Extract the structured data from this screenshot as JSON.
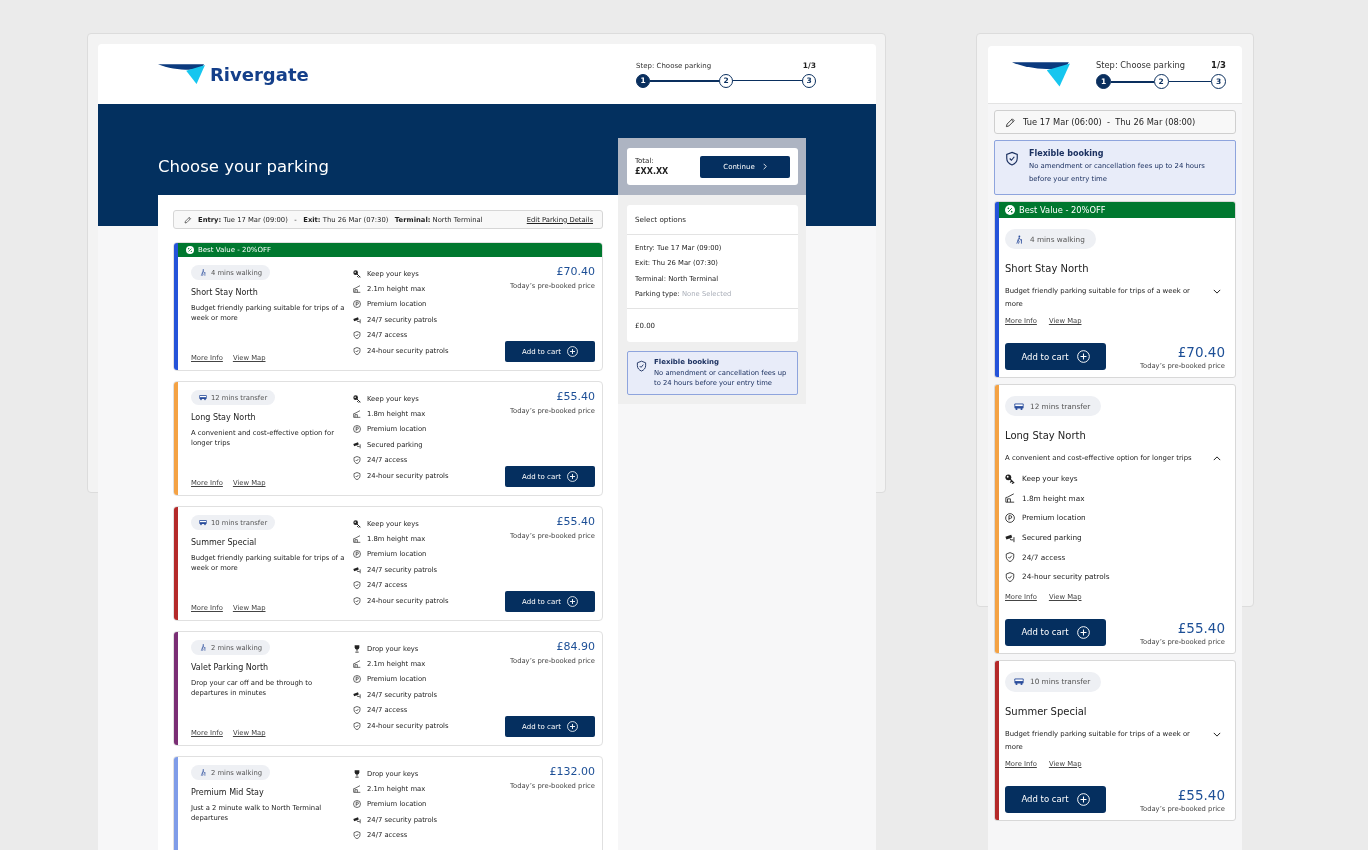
{
  "desktop": {
    "header": {
      "brand": "Rivergate",
      "stepper": {
        "label": "Step: Choose parking",
        "count": "1/3",
        "steps": [
          {
            "number": "1",
            "selected": true
          },
          {
            "number": "2",
            "selected": false
          },
          {
            "number": "3",
            "selected": false
          }
        ]
      }
    },
    "hero_title": "Choose your parking",
    "trip_bar": {
      "summary": "**Entry:** Tue 17 Mar (09:00)   -   **Exit:** Thu 26 Mar (07:30)   **Terminal:** North Terminal",
      "edit_link": "Edit Parking Details"
    },
    "cards": [
      {
        "color": "#2553d9",
        "banner": "Best Value - 20%OFF",
        "badge": {
          "kind": "walking",
          "text": "4 mins walking"
        },
        "name": "Short Stay North",
        "description": "Budget friendly parking suitable for trips of a week or more",
        "features": [
          {
            "kind": "keys",
            "text": "Keep your keys"
          },
          {
            "kind": "height",
            "text": "2.1m height max"
          },
          {
            "kind": "location",
            "text": "Premium location"
          },
          {
            "kind": "cctv",
            "text": "24/7 security patrols"
          },
          {
            "kind": "shield",
            "text": "24/7 access"
          },
          {
            "kind": "shield",
            "text": "24-hour security patrols"
          }
        ],
        "links": [
          "More Info",
          "View Map"
        ],
        "price": "£70.40",
        "price_note": "Today’s pre-booked price",
        "button": "Add to cart"
      },
      {
        "color": "#f4a244",
        "badge": {
          "kind": "transfer",
          "text": "12 mins transfer"
        },
        "name": "Long Stay North",
        "description": "A convenient and cost-effective option for longer trips",
        "features": [
          {
            "kind": "keys",
            "text": "Keep your keys"
          },
          {
            "kind": "height",
            "text": "1.8m height max"
          },
          {
            "kind": "location",
            "text": "Premium location"
          },
          {
            "kind": "cctv",
            "text": "Secured parking"
          },
          {
            "kind": "shield",
            "text": "24/7 access"
          },
          {
            "kind": "shield",
            "text": "24-hour security patrols"
          }
        ],
        "links": [
          "More Info",
          "View Map"
        ],
        "price": "£55.40",
        "price_note": "Today’s pre-booked price",
        "button": "Add to cart"
      },
      {
        "color": "#b42a2a",
        "badge": {
          "kind": "transfer",
          "text": "10 mins transfer"
        },
        "name": "Summer Special",
        "description": "Budget friendly parking suitable for trips of a week or more",
        "features": [
          {
            "kind": "keys",
            "text": "Keep your keys"
          },
          {
            "kind": "height",
            "text": "1.8m height max"
          },
          {
            "kind": "location",
            "text": "Premium location"
          },
          {
            "kind": "cctv",
            "text": "24/7 security patrols"
          },
          {
            "kind": "shield",
            "text": "24/7 access"
          },
          {
            "kind": "shield",
            "text": "24-hour security patrols"
          }
        ],
        "links": [
          "More Info",
          "View Map"
        ],
        "price": "£55.40",
        "price_note": "Today’s pre-booked price",
        "button": "Add to cart"
      },
      {
        "color": "#7a2e74",
        "badge": {
          "kind": "walking",
          "text": "2 mins walking"
        },
        "name": "Valet Parking North",
        "description": "Drop your car off and be through to departures in minutes",
        "features": [
          {
            "kind": "valet",
            "text": "Drop your keys"
          },
          {
            "kind": "height",
            "text": "2.1m height max"
          },
          {
            "kind": "location",
            "text": "Premium location"
          },
          {
            "kind": "cctv",
            "text": "24/7 security patrols"
          },
          {
            "kind": "shield",
            "text": "24/7 access"
          },
          {
            "kind": "shield",
            "text": "24-hour security patrols"
          }
        ],
        "links": [
          "More Info",
          "View Map"
        ],
        "price": "£84.90",
        "price_note": "Today’s pre-booked price",
        "button": "Add to cart"
      },
      {
        "color": "#7f9ce8",
        "badge": {
          "kind": "walking",
          "text": "2 mins walking"
        },
        "name": "Premium Mid Stay",
        "description": "Just a 2 minute walk to North Terminal departures",
        "features": [
          {
            "kind": "valet",
            "text": "Drop your keys"
          },
          {
            "kind": "height",
            "text": "2.1m height max"
          },
          {
            "kind": "location",
            "text": "Premium location"
          },
          {
            "kind": "cctv",
            "text": "24/7 security patrols"
          },
          {
            "kind": "shield",
            "text": "24/7 access"
          }
        ],
        "price": "£132.00",
        "price_note": "Today’s pre-booked price"
      }
    ],
    "summary": {
      "total_label": "Total:",
      "total_value": "£XX.XX",
      "continue_button": "Continue",
      "options_title": "Select options",
      "details": [
        {
          "label": "Entry:",
          "value": "Tue 17 Mar (09:00)",
          "empty": false
        },
        {
          "label": "Exit:",
          "value": "Thu 26 Mar (07:30)",
          "empty": false
        },
        {
          "label": "Terminal:",
          "value": "North Terminal",
          "empty": false
        },
        {
          "label": "Parking type:",
          "value": "None Selected",
          "empty": true
        }
      ],
      "subtotal": "£0.00"
    },
    "flexible_booking": {
      "title": "Flexible booking",
      "text": "No amendment or cancellation fees up to 24 hours before your entry time"
    }
  },
  "mobile": {
    "header": {
      "stepper": {
        "label": "Step: Choose parking",
        "count": "1/3",
        "steps": [
          {
            "number": "1",
            "selected": true
          },
          {
            "number": "2",
            "selected": false
          },
          {
            "number": "3",
            "selected": false
          }
        ]
      }
    },
    "date_bar": "Tue 17 Mar (06:00)  -  Thu 26 Mar (08:00)",
    "flexible_booking": {
      "title": "Flexible booking",
      "text": "No amendment or cancellation fees up to 24 hours before your entry time"
    },
    "cards": [
      {
        "color": "#2553d9",
        "banner": "Best Value - 20%OFF",
        "badge": {
          "kind": "walking",
          "text": "4 mins walking"
        },
        "name": "Short Stay North",
        "description": "Budget friendly parking suitable for trips of a week or more",
        "expanded": false,
        "links": [
          "More Info",
          "View Map"
        ],
        "button": "Add to cart",
        "price": "£70.40",
        "price_note": "Today’s pre-booked price"
      },
      {
        "color": "#f4a244",
        "badge": {
          "kind": "transfer",
          "text": "12 mins transfer"
        },
        "name": "Long Stay North",
        "description": "A convenient and cost-effective option for longer trips",
        "expanded": true,
        "features": [
          {
            "kind": "keys",
            "text": "Keep your keys"
          },
          {
            "kind": "height",
            "text": "1.8m height max"
          },
          {
            "kind": "location",
            "text": "Premium location"
          },
          {
            "kind": "cctv",
            "text": "Secured parking"
          },
          {
            "kind": "shield",
            "text": "24/7 access"
          },
          {
            "kind": "shield",
            "text": "24-hour security patrols"
          }
        ],
        "links": [
          "More Info",
          "View Map"
        ],
        "button": "Add to cart",
        "price": "£55.40",
        "price_note": "Today’s pre-booked price"
      },
      {
        "color": "#b42a2a",
        "badge": {
          "kind": "transfer",
          "text": "10 mins transfer"
        },
        "name": "Summer Special",
        "description": "Budget friendly parking suitable for trips of a week or more",
        "expanded": false,
        "links": [
          "More Info",
          "View Map"
        ],
        "button": "Add to cart",
        "price": "£55.40",
        "price_note": "Today’s pre-booked price"
      }
    ]
  }
}
